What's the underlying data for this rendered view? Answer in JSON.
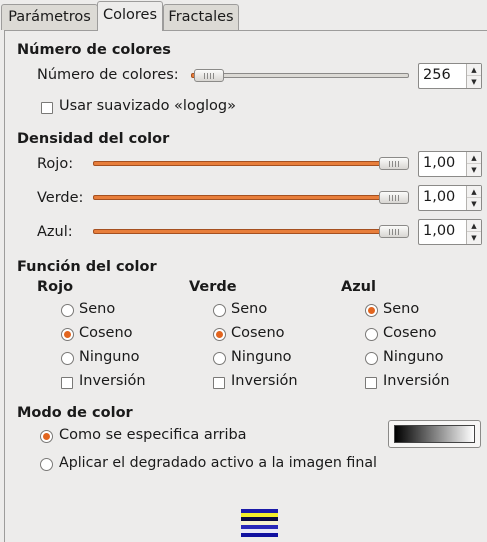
{
  "tabs": [
    {
      "label": "Parámetros",
      "active": false
    },
    {
      "label": "Colores",
      "active": true
    },
    {
      "label": "Fractales",
      "active": false
    }
  ],
  "num_colors": {
    "heading": "Número de colores",
    "label": "Número de colores:",
    "value": "256",
    "smooth_label": "Usar suavizado «loglog»",
    "smooth_checked": false
  },
  "density": {
    "heading": "Densidad del color",
    "red": {
      "label": "Rojo:",
      "value": "1,00"
    },
    "green": {
      "label": "Verde:",
      "value": "1,00"
    },
    "blue": {
      "label": "Azul:",
      "value": "1,00"
    }
  },
  "color_function": {
    "heading": "Función del color",
    "options": [
      "Seno",
      "Coseno",
      "Ninguno"
    ],
    "inversion_label": "Inversión",
    "red": {
      "title": "Rojo",
      "selected": "Coseno",
      "inversion": false
    },
    "green": {
      "title": "Verde",
      "selected": "Coseno",
      "inversion": false
    },
    "blue": {
      "title": "Azul",
      "selected": "Seno",
      "inversion": false
    }
  },
  "color_mode": {
    "heading": "Modo de color",
    "option_specified": "Como se especifica arriba",
    "option_gradient": "Aplicar el degradado activo a la imagen final",
    "selected": "specified"
  },
  "colors": {
    "accent": "#e2651f",
    "slider_fill": "#e87e3b",
    "background": "#edeceb"
  }
}
